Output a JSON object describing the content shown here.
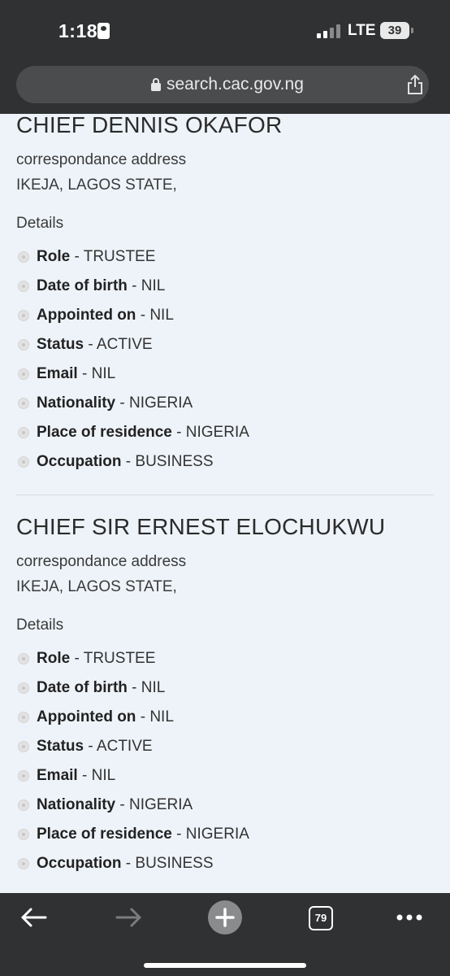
{
  "status_bar": {
    "time": "1:18",
    "network": "LTE",
    "battery": "39"
  },
  "url_bar": {
    "url": "search.cac.gov.ng"
  },
  "people": [
    {
      "name": "CHIEF DENNIS OKAFOR",
      "address_label": "correspondance address",
      "address": "IKEJA, LAGOS STATE,",
      "details_label": "Details",
      "details": [
        {
          "key": "Role",
          "value": "TRUSTEE"
        },
        {
          "key": "Date of birth",
          "value": "NIL"
        },
        {
          "key": "Appointed on",
          "value": "NIL"
        },
        {
          "key": "Status",
          "value": "ACTIVE"
        },
        {
          "key": "Email",
          "value": "NIL"
        },
        {
          "key": "Nationality",
          "value": "NIGERIA"
        },
        {
          "key": "Place of residence",
          "value": "NIGERIA"
        },
        {
          "key": "Occupation",
          "value": "BUSINESS"
        }
      ]
    },
    {
      "name": "CHIEF SIR ERNEST ELOCHUKWU",
      "address_label": "correspondance address",
      "address": "IKEJA, LAGOS STATE,",
      "details_label": "Details",
      "details": [
        {
          "key": "Role",
          "value": "TRUSTEE"
        },
        {
          "key": "Date of birth",
          "value": "NIL"
        },
        {
          "key": "Appointed on",
          "value": "NIL"
        },
        {
          "key": "Status",
          "value": "ACTIVE"
        },
        {
          "key": "Email",
          "value": "NIL"
        },
        {
          "key": "Nationality",
          "value": "NIGERIA"
        },
        {
          "key": "Place of residence",
          "value": "NIGERIA"
        },
        {
          "key": "Occupation",
          "value": "BUSINESS"
        }
      ]
    }
  ],
  "detail_separator": " - ",
  "toolbar": {
    "back_icon": "arrow-left-icon",
    "forward_icon": "arrow-right-icon",
    "new_tab_icon": "plus-circle-icon",
    "tab_count": "79",
    "menu_icon": "more-dots-icon"
  },
  "colors": {
    "chrome": "#303133",
    "page_background": "#eef3f9",
    "url_bar": "#4b4c4e"
  }
}
